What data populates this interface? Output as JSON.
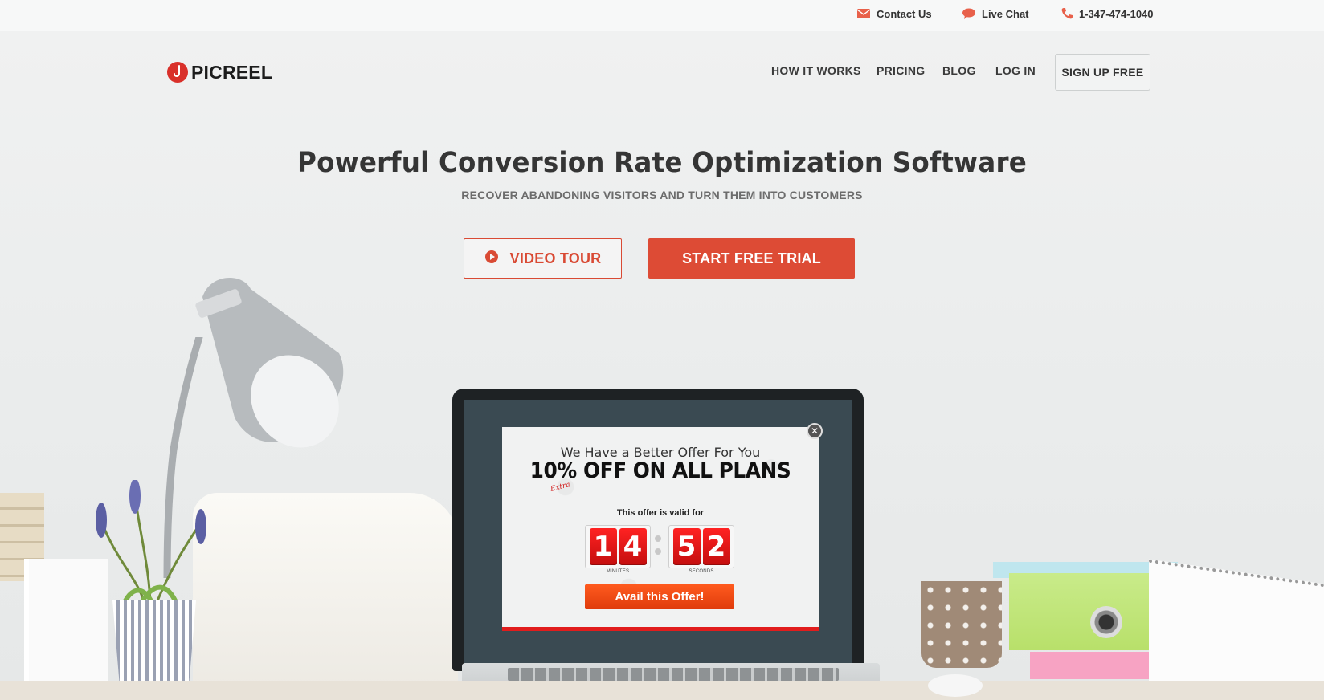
{
  "topbar": {
    "contact_label": "Contact Us",
    "chat_label": "Live Chat",
    "phone_label": "1-347-474-1040"
  },
  "brand": {
    "name": "PICREEL",
    "accent": "#dd4b35"
  },
  "nav": {
    "items": [
      {
        "label": "HOW IT WORKS"
      },
      {
        "label": "PRICING"
      },
      {
        "label": "BLOG"
      },
      {
        "label": "LOG IN"
      }
    ],
    "signup_label": "SIGN UP FREE"
  },
  "hero": {
    "headline": "Powerful Conversion Rate Optimization Software",
    "subhead": "RECOVER ABANDONING VISITORS AND TURN THEM INTO CUSTOMERS",
    "video_tour_label": "VIDEO TOUR",
    "trial_label": "START FREE TRIAL"
  },
  "popup": {
    "title": "We Have a Better Offer For You",
    "offer": "10% OFF ON ALL PLANS",
    "extra": "Extra",
    "valid_text": "This offer is valid for",
    "minutes_digits": [
      "1",
      "4"
    ],
    "seconds_digits": [
      "5",
      "2"
    ],
    "minutes_label": "MINUTES",
    "seconds_label": "SECONDS",
    "cta_label": "Avail this Offer!",
    "close_glyph": "✕"
  }
}
